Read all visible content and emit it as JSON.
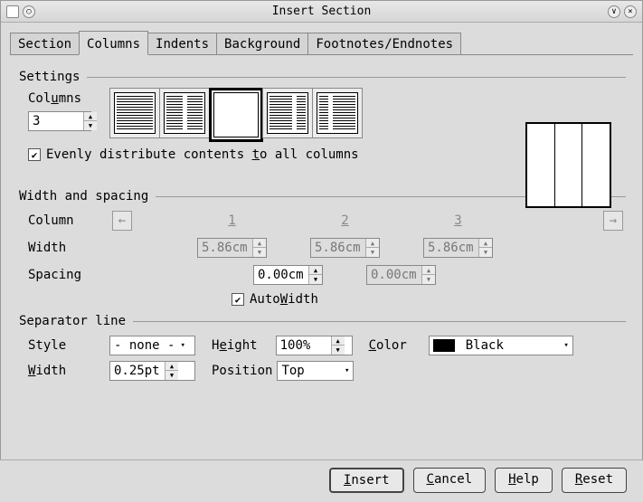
{
  "window": {
    "title": "Insert Section"
  },
  "tabs": [
    "Section",
    "Columns",
    "Indents",
    "Background",
    "Footnotes/Endnotes"
  ],
  "active_tab": "Columns",
  "settings": {
    "heading": "Settings",
    "columns_label_pre": "Col",
    "columns_label_uchar": "u",
    "columns_label_post": "mns",
    "columns_value": "3",
    "evenly_pre": "Evenly distribute contents ",
    "evenly_uchar": "t",
    "evenly_post": "o all columns",
    "evenly_checked": true
  },
  "width_spacing": {
    "heading": "Width and spacing",
    "column_label": "Column",
    "width_label": "Width",
    "spacing_label": "Spacing",
    "col_headers": [
      "1",
      "2",
      "3"
    ],
    "widths": [
      "5.86cm",
      "5.86cm",
      "5.86cm"
    ],
    "spacings": [
      "0.00cm",
      "0.00cm"
    ],
    "autowidth_pre": "Auto",
    "autowidth_uchar": "W",
    "autowidth_post": "idth",
    "autowidth_checked": true
  },
  "separator": {
    "heading": "Separator line",
    "style_label": "Style",
    "style_value": "- none -",
    "width_label_pre": "",
    "width_uchar": "W",
    "width_label_post": "idth",
    "width_value": "0.25pt",
    "height_label_pre": "H",
    "height_uchar": "e",
    "height_label_post": "ight",
    "height_value": "100%",
    "position_label": "Position",
    "position_value": "Top",
    "color_label_pre": "",
    "color_uchar": "C",
    "color_label_post": "olor",
    "color_value": "Black"
  },
  "buttons": {
    "insert": "Insert",
    "insert_u": "I",
    "cancel": "Cancel",
    "cancel_u": "C",
    "help": "Help",
    "help_u": "H",
    "reset": "Reset",
    "reset_u": "R"
  }
}
